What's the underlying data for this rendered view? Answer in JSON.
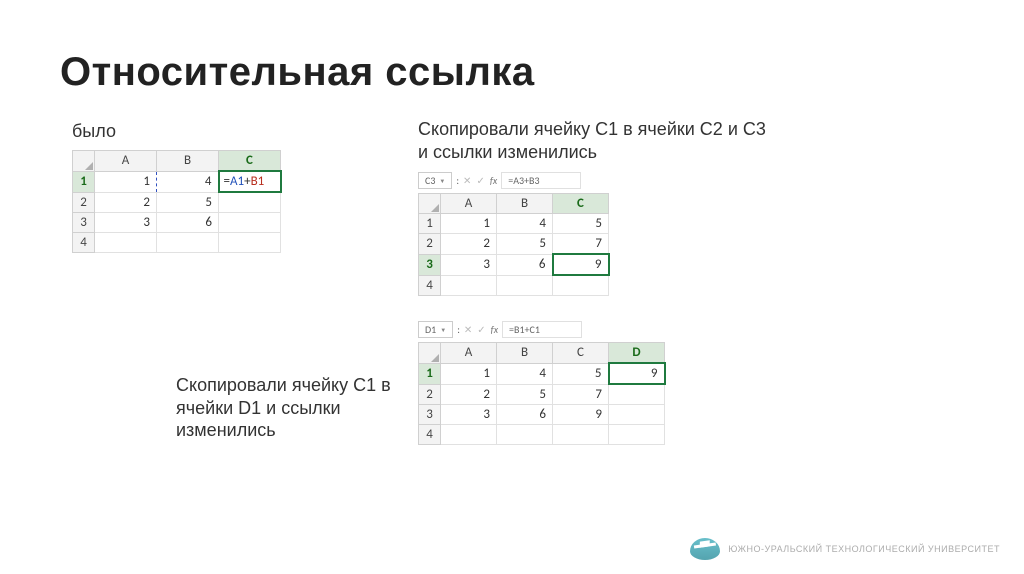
{
  "title": "Относительная ссылка",
  "labels": {
    "was": "было",
    "copied_c2c3": "Скопировали ячейку С1 в ячейки С2 и С3 и ссылки изменились",
    "copied_d1": "Скопировали ячейку С1 в ячейки D1 и ссылки изменились"
  },
  "footer": "ЮЖНО-УРАЛЬСКИЙ ТЕХНОЛОГИЧЕСКИЙ УНИВЕРСИТЕТ",
  "example1": {
    "cols": [
      "A",
      "B",
      "C"
    ],
    "rows": [
      "1",
      "2",
      "3",
      "4"
    ],
    "a1": "1",
    "b1": "4",
    "a2": "2",
    "b2": "5",
    "a3": "3",
    "b3": "6",
    "c1_eq": "=",
    "c1_ref1": "A1",
    "c1_plus": "+",
    "c1_ref2": "B1"
  },
  "example2": {
    "namebox": "C3",
    "formula": "=A3+B3",
    "fx": "fx",
    "cols": [
      "A",
      "B",
      "C"
    ],
    "rows": [
      "1",
      "2",
      "3",
      "4"
    ],
    "a1": "1",
    "b1": "4",
    "c1": "5",
    "a2": "2",
    "b2": "5",
    "c2": "7",
    "a3": "3",
    "b3": "6",
    "c3": "9"
  },
  "example3": {
    "namebox": "D1",
    "formula": "=B1+C1",
    "fx": "fx",
    "cols": [
      "A",
      "B",
      "C",
      "D"
    ],
    "rows": [
      "1",
      "2",
      "3",
      "4"
    ],
    "a1": "1",
    "b1": "4",
    "c1": "5",
    "d1": "9",
    "a2": "2",
    "b2": "5",
    "c2": "7",
    "a3": "3",
    "b3": "6",
    "c3": "9"
  }
}
